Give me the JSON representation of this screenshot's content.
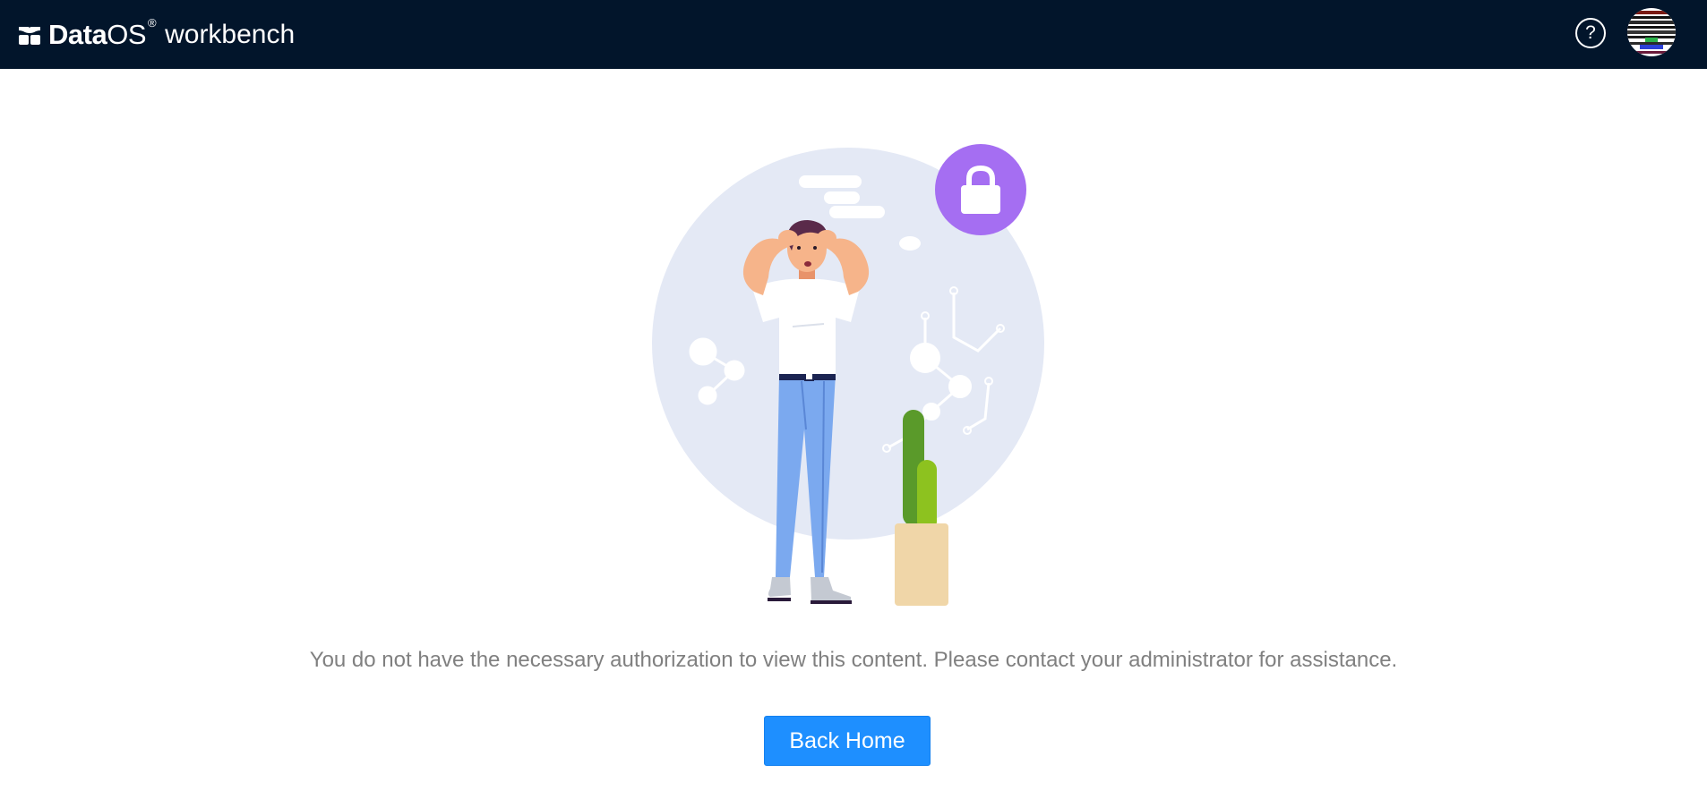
{
  "header": {
    "brand_name_bold": "Data",
    "brand_name_regular": "OS",
    "brand_mark": "®",
    "brand_suffix": "workbench",
    "help_icon": "help-circle-icon",
    "help_glyph": "?",
    "avatar_icon": "user-avatar"
  },
  "main": {
    "illustration_icon": "access-denied-illustration",
    "lock_icon": "lock-icon",
    "message": "You do not have the necessary authorization to view this content. Please contact your administrator for assistance.",
    "back_home_label": "Back Home"
  },
  "colors": {
    "topbar_bg": "#02152b",
    "primary_button": "#1e8fff",
    "message_text": "#808080",
    "lock_circle": "#a56ef2",
    "background_circle": "#e4e9f5"
  }
}
